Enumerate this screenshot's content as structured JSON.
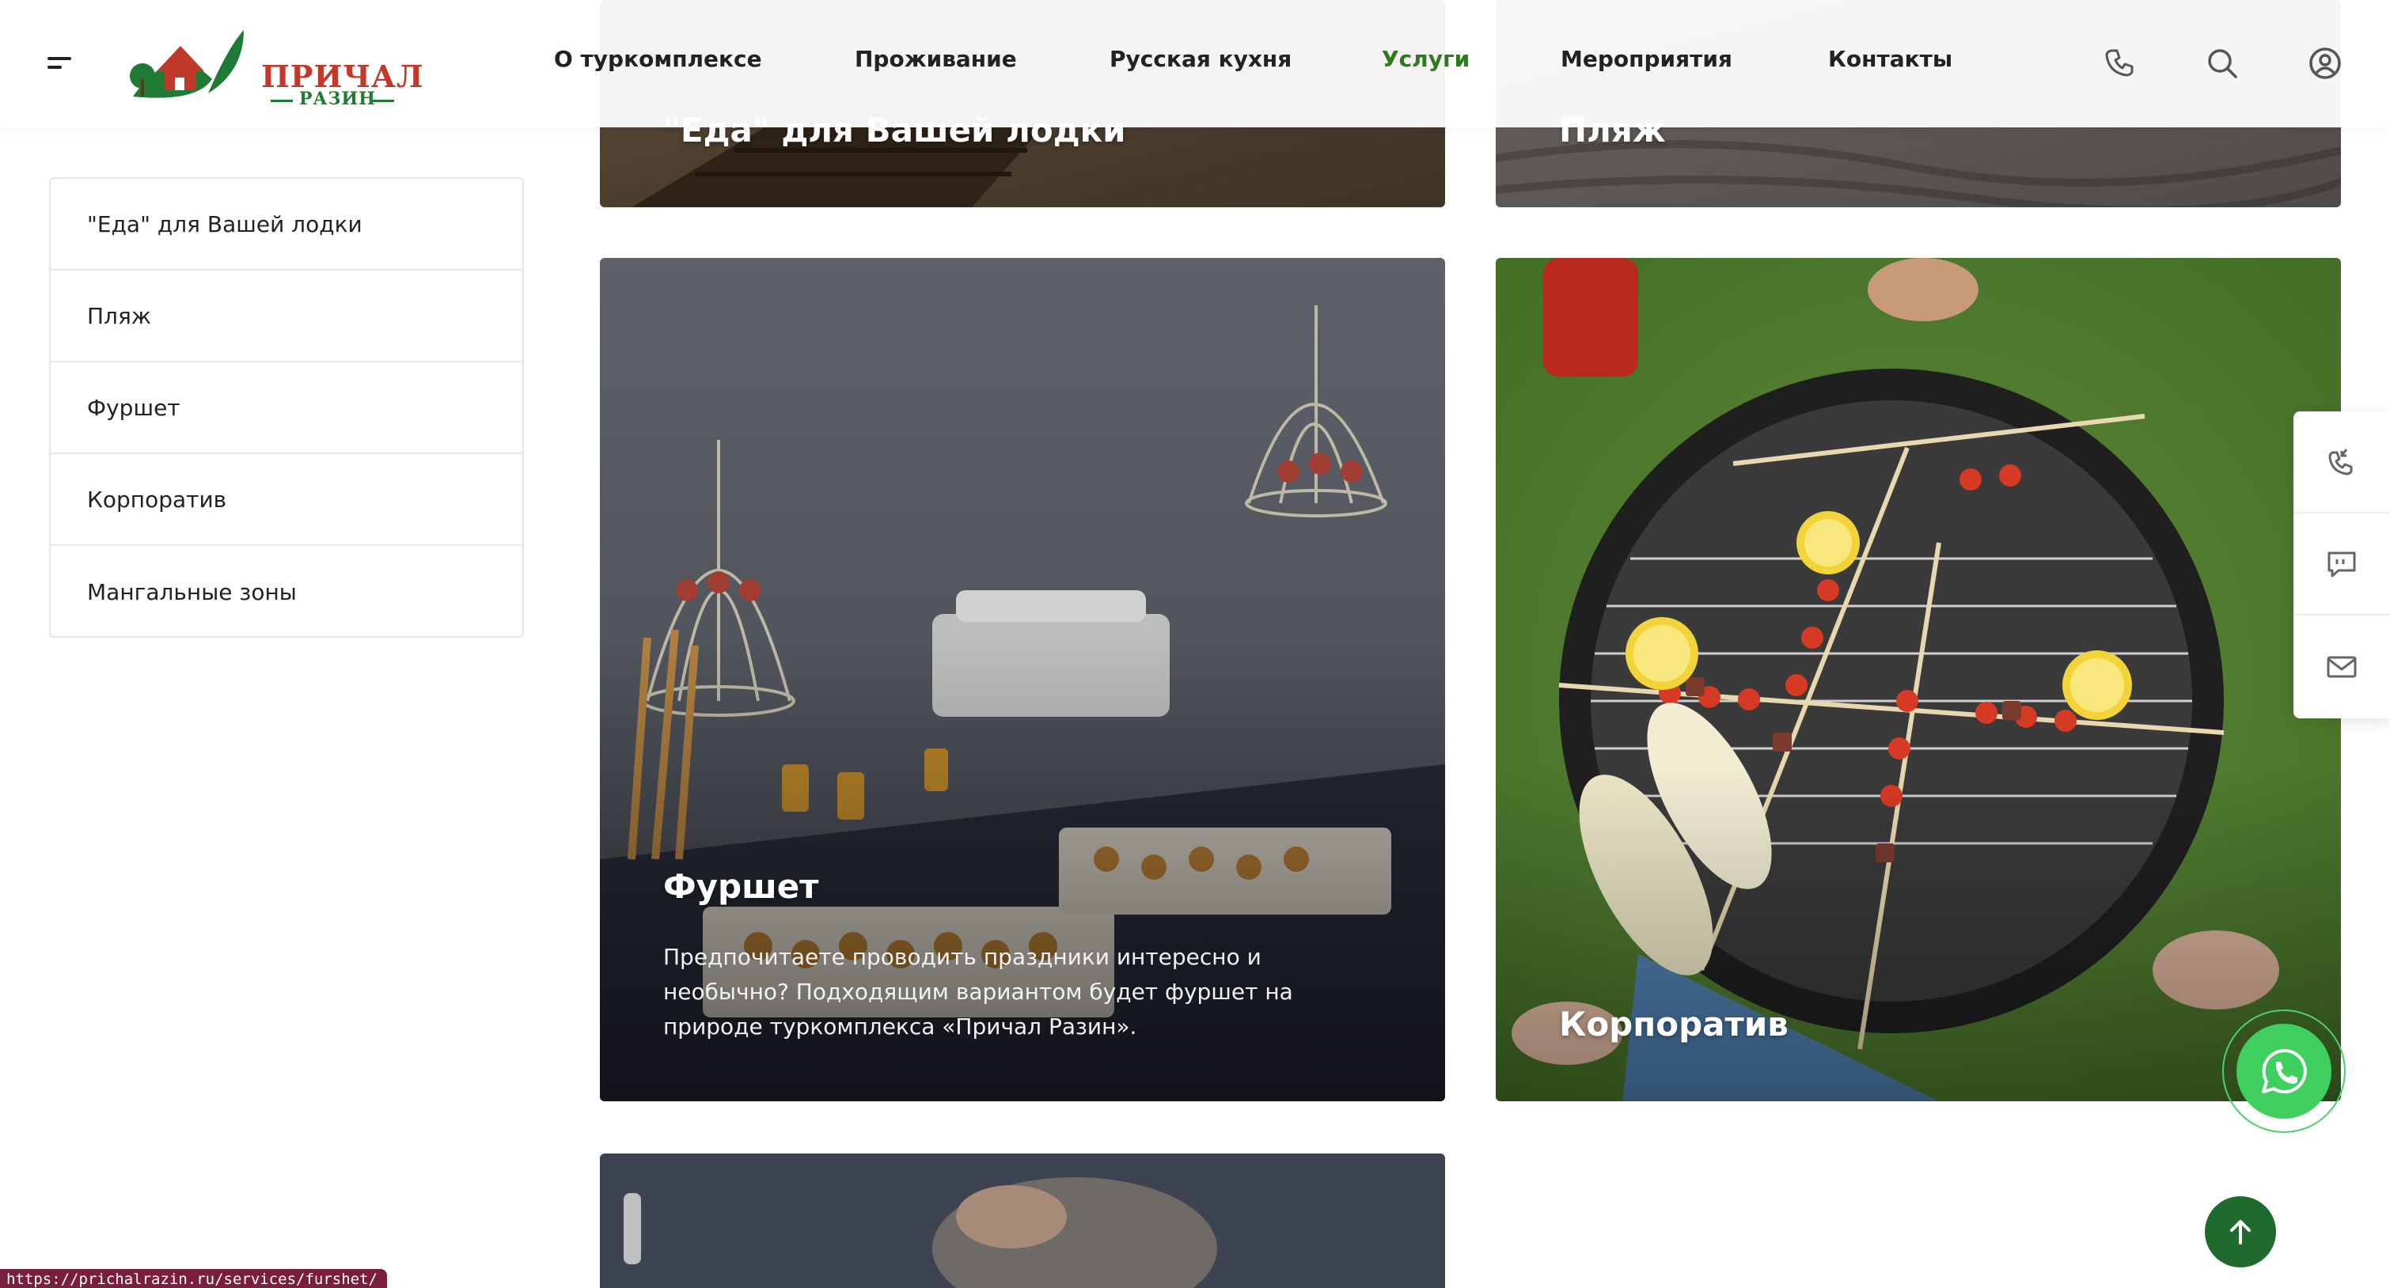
{
  "logo": {
    "line1": "ПРИЧАЛ",
    "line2": "РАЗИН"
  },
  "nav": {
    "items": [
      "О туркомплексе",
      "Проживание",
      "Русская кухня",
      "Услуги",
      "Мероприятия",
      "Контакты"
    ],
    "active": "Услуги"
  },
  "header_icons": [
    "phone-icon",
    "search-icon",
    "user-icon"
  ],
  "sidebar": {
    "items": [
      "\"Еда\" для Вашей лодки",
      "Пляж",
      "Фуршет",
      "Корпоратив",
      "Мангальные зоны"
    ]
  },
  "cards": {
    "boat_food": {
      "title": "\"Еда\" для Вашей лодки"
    },
    "beach": {
      "title": "Пляж"
    },
    "furshet": {
      "title": "Фуршет",
      "desc": "Предпочитаете проводить праздники интересно и необычно? Подходящим вариантом будет фуршет на природе туркомплекса «Причал Разин»."
    },
    "corporate": {
      "title": "Корпоратив"
    }
  },
  "side_panel": [
    "callback-icon",
    "chat-icon",
    "mail-icon"
  ],
  "floating": {
    "whatsapp": "whatsapp-icon",
    "scroll_up": "arrow-up-icon"
  },
  "status_bar": {
    "url": "https://prichalrazin.ru/services/furshet/"
  },
  "colors": {
    "brand_green": "#2d7a1f",
    "brand_red": "#c0392b",
    "whatsapp": "#3ecf5f",
    "up_button": "#1f6b2d"
  }
}
